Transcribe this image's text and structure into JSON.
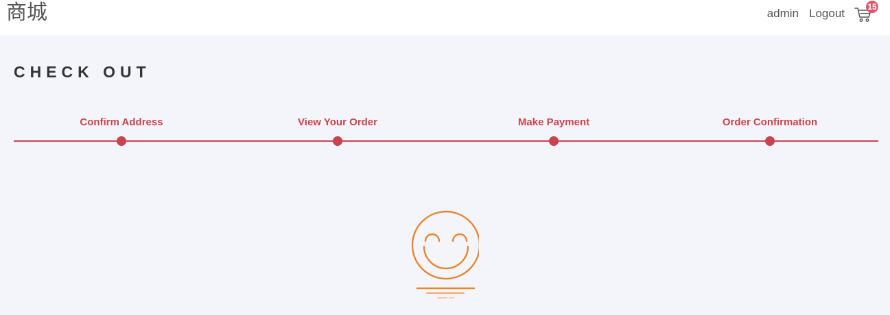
{
  "header": {
    "logo": "商城",
    "user": "admin",
    "logout": "Logout",
    "cart_count": "15",
    "cart_icon": "cart-icon"
  },
  "page": {
    "title": "CHECK OUT"
  },
  "steps": [
    {
      "label": "Confirm Address"
    },
    {
      "label": "View Your Order"
    },
    {
      "label": "Make Payment"
    },
    {
      "label": "Order Confirmation"
    }
  ],
  "illustration": {
    "icon": "smiley-face-icon"
  },
  "colors": {
    "accent": "#c9434e",
    "badge": "#e0576b",
    "smiley": "#e8852f",
    "background": "#f4f5fa"
  }
}
